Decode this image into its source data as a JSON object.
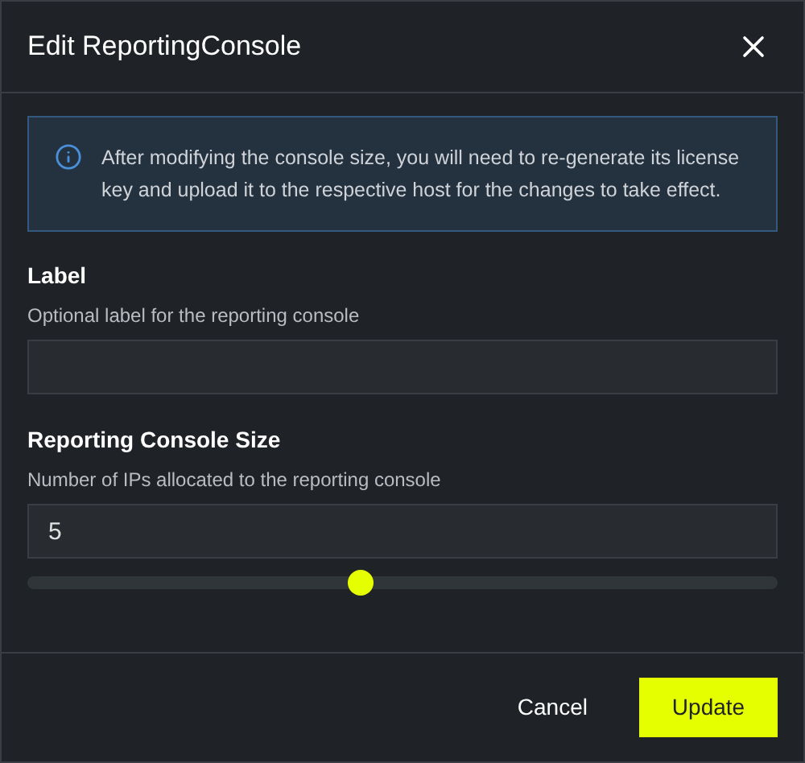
{
  "dialog": {
    "title": "Edit ReportingConsole"
  },
  "info": {
    "message": "After modifying the console size, you will need to re-generate its license key and upload it to the respective host for the changes to take effect."
  },
  "label_field": {
    "label": "Label",
    "description": "Optional label for the reporting console"
  },
  "size_field": {
    "label": "Reporting Console Size",
    "description": "Number of IPs allocated to the reporting console",
    "value": "5"
  },
  "slider": {
    "level": 0.444
  },
  "buttons": [
    "Cancel",
    "Update"
  ]
}
